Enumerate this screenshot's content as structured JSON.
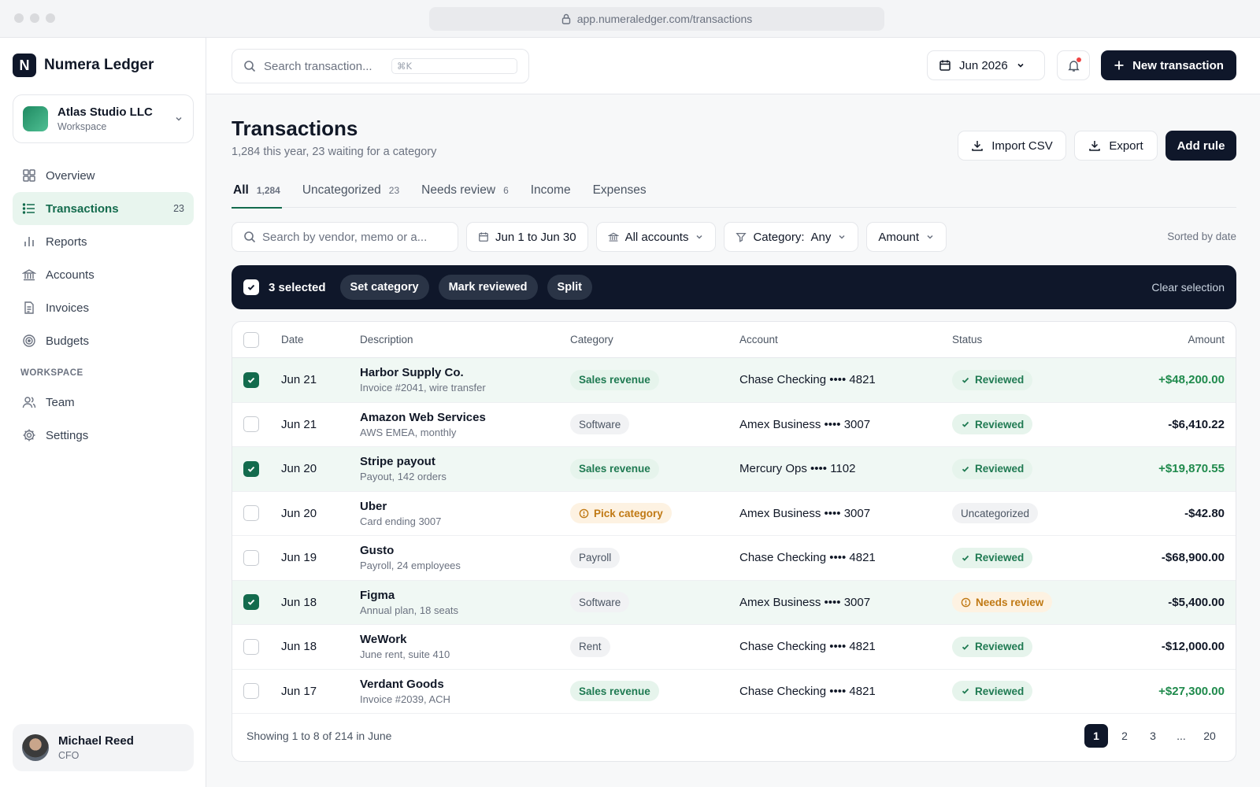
{
  "browser": {
    "url": "app.numeraledger.com/transactions"
  },
  "brand": {
    "logo_letter": "N",
    "name": "Numera Ledger"
  },
  "workspace": {
    "name": "Atlas Studio LLC",
    "sub": "Workspace"
  },
  "nav": {
    "items": [
      {
        "label": "Overview",
        "icon": "grid-icon"
      },
      {
        "label": "Transactions",
        "icon": "list-icon",
        "count": "23",
        "active": true
      },
      {
        "label": "Reports",
        "icon": "bar-chart-icon"
      },
      {
        "label": "Accounts",
        "icon": "bank-icon"
      },
      {
        "label": "Invoices",
        "icon": "document-icon"
      },
      {
        "label": "Budgets",
        "icon": "target-icon"
      }
    ],
    "section_label": "WORKSPACE",
    "workspace_items": [
      {
        "label": "Team",
        "icon": "users-icon"
      },
      {
        "label": "Settings",
        "icon": "gear-icon"
      }
    ]
  },
  "user": {
    "name": "Michael Reed",
    "role": "CFO"
  },
  "topbar": {
    "search_placeholder": "Search transaction...",
    "search_shortcut": "⌘K",
    "date_label": "Jun 2026",
    "new_button": "New transaction"
  },
  "page": {
    "title": "Transactions",
    "subtitle": "1,284 this year, 23 waiting for a category",
    "import_label": "Import CSV",
    "export_label": "Export",
    "rule_label": "Add rule"
  },
  "tabs": [
    {
      "label": "All",
      "count": "1,284",
      "active": true
    },
    {
      "label": "Uncategorized",
      "count": "23"
    },
    {
      "label": "Needs review",
      "count": "6"
    },
    {
      "label": "Income",
      "count": ""
    },
    {
      "label": "Expenses",
      "count": ""
    }
  ],
  "filters": {
    "search_placeholder": "Search by vendor, memo or a...",
    "date_range": "Jun 1 to Jun 30",
    "accounts": "All accounts",
    "category_label": "Category:",
    "category_value": "Any",
    "amount": "Amount",
    "sorted": "Sorted by date"
  },
  "bulk": {
    "selected": "3 selected",
    "set_category": "Set category",
    "mark_reviewed": "Mark reviewed",
    "split": "Split",
    "clear": "Clear selection"
  },
  "table": {
    "headers": {
      "date": "Date",
      "description": "Description",
      "category": "Category",
      "account": "Account",
      "status": "Status",
      "amount": "Amount"
    },
    "rows": [
      {
        "selected": true,
        "date": "Jun 21",
        "vendor": "Harbor Supply Co.",
        "memo": "Invoice #2041, wire transfer",
        "category": "Sales revenue",
        "cat_style": "green",
        "account": "Chase Checking •••• 4821",
        "status": "Reviewed",
        "status_style": "green",
        "amount": "+$48,200.00",
        "positive": true
      },
      {
        "selected": false,
        "date": "Jun 21",
        "vendor": "Amazon Web Services",
        "memo": "AWS EMEA, monthly",
        "category": "Software",
        "cat_style": "gray",
        "account": "Amex Business •••• 3007",
        "status": "Reviewed",
        "status_style": "green",
        "amount": "-$6,410.22",
        "positive": false
      },
      {
        "selected": true,
        "date": "Jun 20",
        "vendor": "Stripe payout",
        "memo": "Payout, 142 orders",
        "category": "Sales revenue",
        "cat_style": "green",
        "account": "Mercury Ops •••• 1102",
        "status": "Reviewed",
        "status_style": "green",
        "amount": "+$19,870.55",
        "positive": true
      },
      {
        "selected": false,
        "date": "Jun 20",
        "vendor": "Uber",
        "memo": "Card ending 3007",
        "category": "Pick category",
        "cat_style": "amber",
        "account": "Amex Business •••• 3007",
        "status": "Uncategorized",
        "status_style": "gray",
        "amount": "-$42.80",
        "positive": false
      },
      {
        "selected": false,
        "date": "Jun 19",
        "vendor": "Gusto",
        "memo": "Payroll, 24 employees",
        "category": "Payroll",
        "cat_style": "gray",
        "account": "Chase Checking •••• 4821",
        "status": "Reviewed",
        "status_style": "green",
        "amount": "-$68,900.00",
        "positive": false
      },
      {
        "selected": true,
        "date": "Jun 18",
        "vendor": "Figma",
        "memo": "Annual plan, 18 seats",
        "category": "Software",
        "cat_style": "gray",
        "account": "Amex Business •••• 3007",
        "status": "Needs review",
        "status_style": "amber",
        "amount": "-$5,400.00",
        "positive": false
      },
      {
        "selected": false,
        "date": "Jun 18",
        "vendor": "WeWork",
        "memo": "June rent, suite 410",
        "category": "Rent",
        "cat_style": "gray",
        "account": "Chase Checking •••• 4821",
        "status": "Reviewed",
        "status_style": "green",
        "amount": "-$12,000.00",
        "positive": false
      },
      {
        "selected": false,
        "date": "Jun 17",
        "vendor": "Verdant Goods",
        "memo": "Invoice #2039, ACH",
        "category": "Sales revenue",
        "cat_style": "green",
        "account": "Chase Checking •••• 4821",
        "status": "Reviewed",
        "status_style": "green",
        "amount": "+$27,300.00",
        "positive": true
      }
    ],
    "footer": "Showing 1 to 8 of 214 in June",
    "pages": [
      "1",
      "2",
      "3",
      "...",
      "20"
    ],
    "current_page": "1"
  },
  "colors": {
    "accent": "#136b4d",
    "dark": "#0f172a",
    "positive": "#1f8a4c",
    "amber": "#c07914"
  }
}
